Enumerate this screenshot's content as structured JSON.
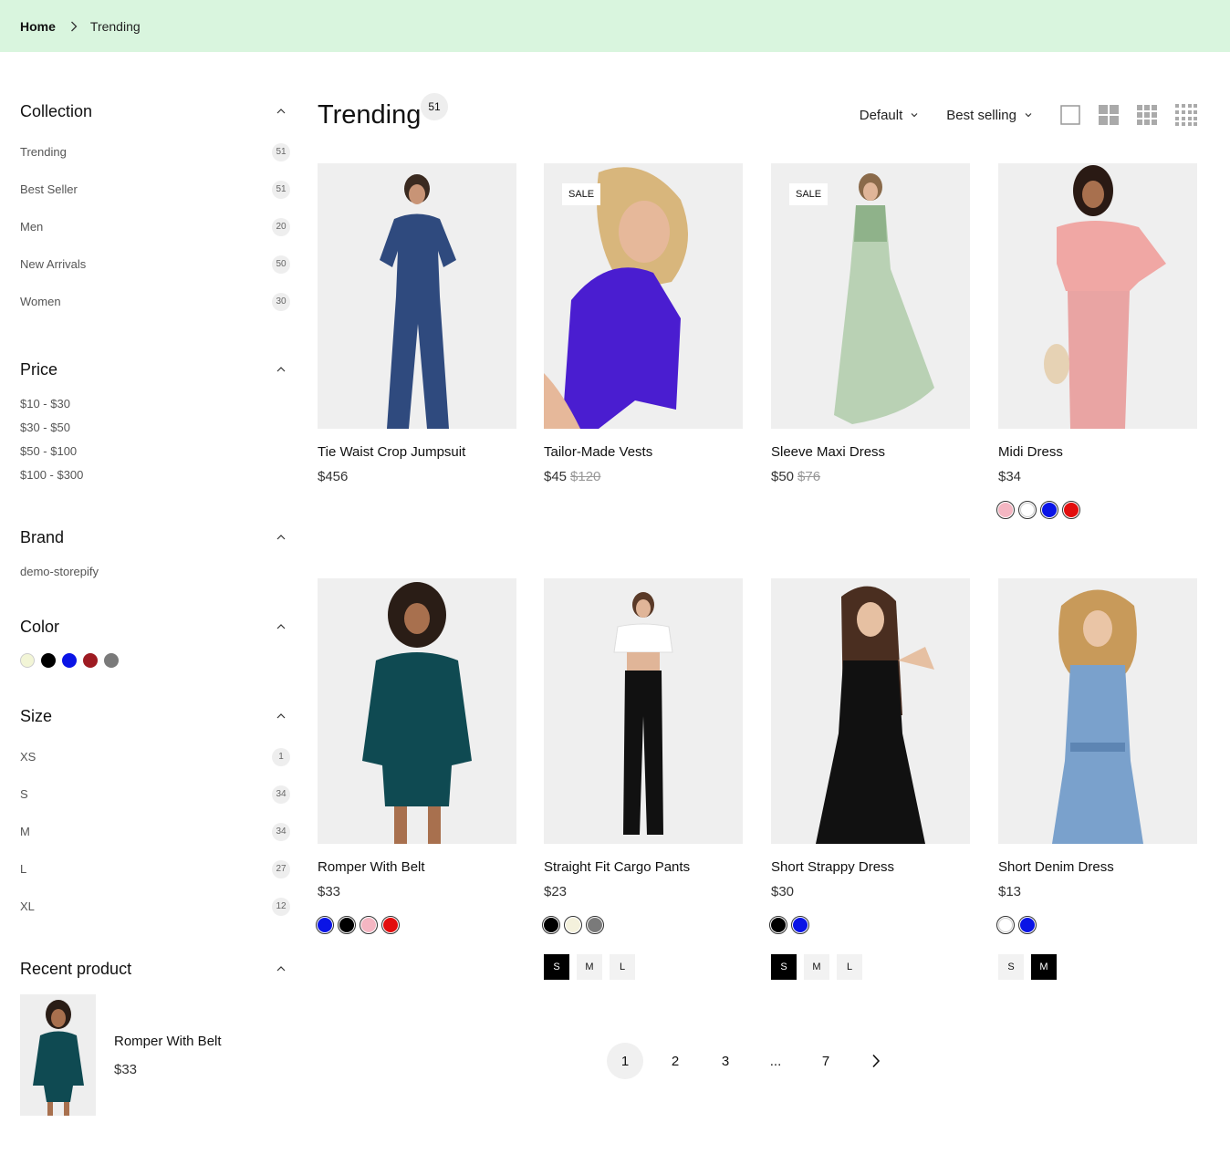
{
  "breadcrumb": {
    "home": "Home",
    "current": "Trending"
  },
  "sidebar": {
    "collection": {
      "title": "Collection",
      "items": [
        {
          "label": "Trending",
          "count": "51"
        },
        {
          "label": "Best Seller",
          "count": "51"
        },
        {
          "label": "Men",
          "count": "20"
        },
        {
          "label": "New Arrivals",
          "count": "50"
        },
        {
          "label": "Women",
          "count": "30"
        }
      ]
    },
    "price": {
      "title": "Price",
      "items": [
        "$10 - $30",
        "$30 - $50",
        "$50 - $100",
        "$100 - $300"
      ]
    },
    "brand": {
      "title": "Brand",
      "items": [
        "demo-storepify"
      ]
    },
    "color": {
      "title": "Color",
      "swatches": [
        "#f2f5d6",
        "#000000",
        "#0a14e6",
        "#9e1b22",
        "#7a7a7a"
      ]
    },
    "size": {
      "title": "Size",
      "items": [
        {
          "label": "XS",
          "count": "1"
        },
        {
          "label": "S",
          "count": "34"
        },
        {
          "label": "M",
          "count": "34"
        },
        {
          "label": "L",
          "count": "27"
        },
        {
          "label": "XL",
          "count": "12"
        }
      ]
    },
    "recent": {
      "title": "Recent product",
      "name": "Romper With Belt",
      "price": "$33"
    }
  },
  "main": {
    "title": "Trending",
    "count": "51",
    "sort_default": "Default",
    "sort_best": "Best selling"
  },
  "products": [
    {
      "name": "Tie Waist Crop Jumpsuit",
      "price": "$456",
      "old_price": "",
      "sale": "",
      "swatches": [],
      "sizes": []
    },
    {
      "name": "Tailor-Made Vests",
      "price": "$45",
      "old_price": "$120",
      "sale": "SALE",
      "swatches": [],
      "sizes": []
    },
    {
      "name": "Sleeve Maxi Dress",
      "price": "$50",
      "old_price": "$76",
      "sale": "SALE",
      "swatches": [],
      "sizes": []
    },
    {
      "name": "Midi Dress",
      "price": "$34",
      "old_price": "",
      "sale": "",
      "swatches": [
        "#f4b6c2",
        "#ffffff",
        "#0a14e6",
        "#e30d0d"
      ],
      "sizes": []
    },
    {
      "name": "Romper With Belt",
      "price": "$33",
      "old_price": "",
      "sale": "",
      "swatches": [
        "#0a14e6",
        "#000000",
        "#f4b6c2",
        "#e30d0d"
      ],
      "sizes": []
    },
    {
      "name": "Straight Fit Cargo Pants",
      "price": "$23",
      "old_price": "",
      "sale": "",
      "swatches": [
        "#000000",
        "#f4f1dc",
        "#7a7a7a"
      ],
      "sizes": [
        {
          "label": "S",
          "active": true
        },
        {
          "label": "M",
          "active": false
        },
        {
          "label": "L",
          "active": false
        }
      ]
    },
    {
      "name": "Short Strappy Dress",
      "price": "$30",
      "old_price": "",
      "sale": "",
      "swatches": [
        "#000000",
        "#0a14e6"
      ],
      "sizes": [
        {
          "label": "S",
          "active": true
        },
        {
          "label": "M",
          "active": false
        },
        {
          "label": "L",
          "active": false
        }
      ]
    },
    {
      "name": "Short Denim Dress",
      "price": "$13",
      "old_price": "",
      "sale": "",
      "swatches": [
        "#ffffff",
        "#0a14e6"
      ],
      "sizes": [
        {
          "label": "S",
          "active": false
        },
        {
          "label": "M",
          "active": true
        }
      ]
    }
  ],
  "pagination": [
    "1",
    "2",
    "3",
    "...",
    "7"
  ]
}
